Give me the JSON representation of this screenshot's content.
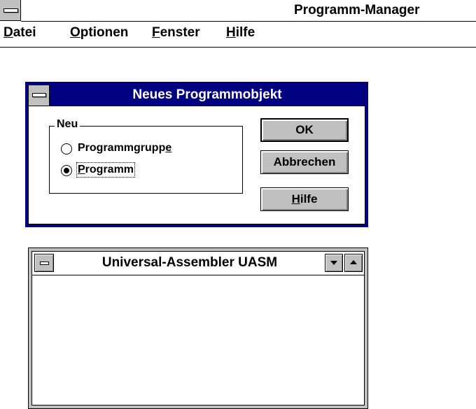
{
  "app": {
    "title": "Programm-Manager",
    "menu": {
      "datei": {
        "underlined": "D",
        "rest": "atei"
      },
      "optionen": {
        "underlined": "O",
        "rest": "ptionen"
      },
      "fenster": {
        "underlined": "F",
        "rest": "enster"
      },
      "hilfe": {
        "underlined": "H",
        "rest": "ilfe"
      }
    }
  },
  "dialog": {
    "title": "Neues Programmobjekt",
    "group_label": "Neu",
    "options": [
      {
        "before": "Programmgrupp",
        "underlined": "e",
        "after": "",
        "selected": false
      },
      {
        "before": "",
        "underlined": "P",
        "after": "rogramm",
        "selected": true
      }
    ],
    "buttons": {
      "ok": "OK",
      "cancel": "Abbrechen",
      "help_underlined": "H",
      "help_rest": "ilfe"
    },
    "title_bar_color": "#000080"
  },
  "group_window": {
    "title": "Universal-Assembler UASM"
  },
  "colors": {
    "active_title": "#000080",
    "button_face": "#c0c0c0",
    "window": "#ffffff"
  },
  "icons": {
    "system_menu": "system-menu-icon",
    "minimize": "minimize-arrow-icon",
    "maximize": "maximize-arrow-icon",
    "radio_off": "radio-unselected-icon",
    "radio_on": "radio-selected-icon"
  }
}
